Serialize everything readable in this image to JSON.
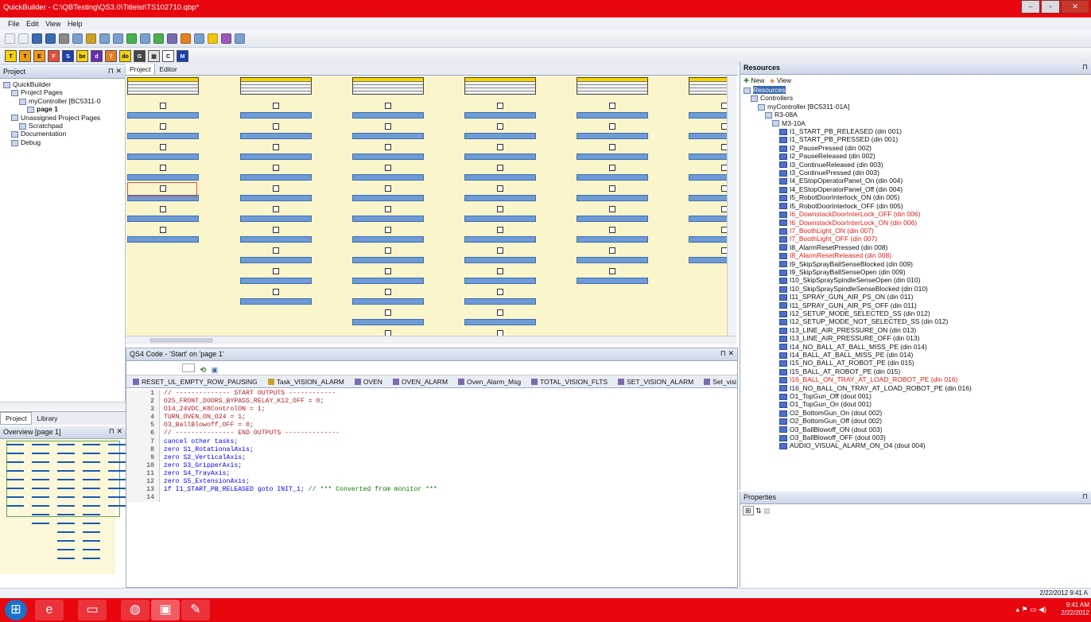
{
  "window": {
    "title": "QuickBuilder - C:\\QBTesting\\QS3.0\\Titleist\\TS102710.qbp*",
    "minimize": "–",
    "maximize": "▫",
    "close": "✕"
  },
  "menu": [
    "File",
    "Edit",
    "View",
    "Help"
  ],
  "toolbar2": [
    {
      "t": "T",
      "c": "#f7d300",
      "fg": "#000"
    },
    {
      "t": "T",
      "c": "#f39c12",
      "fg": "#000"
    },
    {
      "t": "E",
      "c": "#f39c12",
      "fg": "#000"
    },
    {
      "t": "F",
      "c": "#e74c3c",
      "fg": "#fff"
    },
    {
      "t": "S",
      "c": "#1a3fb0",
      "fg": "#fff"
    },
    {
      "t": "be",
      "c": "#f7d300",
      "fg": "#000"
    },
    {
      "t": "d",
      "c": "#6b2bb0",
      "fg": "#fff"
    },
    {
      "t": "?",
      "c": "#e67e22",
      "fg": "#fff"
    },
    {
      "t": "do",
      "c": "#f7d300",
      "fg": "#000"
    },
    {
      "t": "G",
      "c": "#444",
      "fg": "#fff"
    },
    {
      "t": "▦",
      "c": "#e0e0e0",
      "fg": "#333"
    },
    {
      "t": "C",
      "c": "#fff",
      "fg": "#000"
    },
    {
      "t": "M",
      "c": "#1a3fb0",
      "fg": "#fff"
    }
  ],
  "project": {
    "panel_title": "Project",
    "pin": "⊓ ✕",
    "tree": [
      {
        "label": "QuickBuilder",
        "indent": 0
      },
      {
        "label": "Project Pages",
        "indent": 1
      },
      {
        "label": "myController [BC5311-0",
        "indent": 2
      },
      {
        "label": "page 1",
        "indent": 3,
        "bold": true
      },
      {
        "label": "Unassigned Project Pages",
        "indent": 1
      },
      {
        "label": "Scratchpad",
        "indent": 2
      },
      {
        "label": "Documentation",
        "indent": 1
      },
      {
        "label": "Debug",
        "indent": 1
      }
    ],
    "tab_project": "Project",
    "tab_library": "Library"
  },
  "overview": {
    "title": "Overview [page 1]",
    "pin": "⊓ ✕"
  },
  "editor": {
    "tab_project": "Project",
    "tab_editor": "Editor"
  },
  "code": {
    "title": "QS4 Code - 'Start' on 'page 1'",
    "pin": "⊓ ✕",
    "tabs": [
      "RESET_UL_EMPTY_ROW_PAUSING",
      "Task_VISION_ALARM",
      "OVEN",
      "OVEN_ALARM",
      "Oven_Alarm_Msg",
      "TOTAL_VISION_FLTS",
      "SET_VISION_ALARM",
      "Set_visi"
    ],
    "lines": [
      {
        "n": "1",
        "text": "// -------------- START OUTPUTS ------------",
        "cls": "plain"
      },
      {
        "n": "2",
        "text": "O25_FRONT_DOORS_BYPASS_RELAY_K12_OFF = 0;",
        "cls": "plain"
      },
      {
        "n": "3",
        "text": "O14_24VDC_K8ControlON = 1;",
        "cls": "plain"
      },
      {
        "n": "4",
        "text": "TURN_OVEN_ON_O24 = 1;",
        "cls": "plain"
      },
      {
        "n": "5",
        "text": "O3_BallBlowoff_OFF = 0;",
        "cls": "plain"
      },
      {
        "n": "6",
        "text": "// --------------- END OUTPUTS --------------",
        "cls": "plain"
      },
      {
        "n": "7",
        "text": "cancel other tasks;",
        "cls": "kw"
      },
      {
        "n": "8",
        "text": "zero S1_RotationalAxis;",
        "cls": "kw"
      },
      {
        "n": "9",
        "text": "zero S2_VerticalAxis;",
        "cls": "kw"
      },
      {
        "n": "10",
        "text": "zero S3_GripperAxis;",
        "cls": "kw"
      },
      {
        "n": "11",
        "text": "zero S4_TrayAxis;",
        "cls": "kw"
      },
      {
        "n": "12",
        "text": "zero S5_ExtensionAxis;",
        "cls": "kw"
      },
      {
        "n": "13",
        "text": "if I1_START_PB_RELEASED goto INIT_1; // *** Converted from monitor ***",
        "cls": "kw"
      },
      {
        "n": "14",
        "text": "",
        "cls": "plain"
      }
    ]
  },
  "resources": {
    "title": "Resources",
    "new": "New",
    "view": "View",
    "root": "Resources",
    "controllers": "Controllers",
    "controller": "myController [BC5311-01A]",
    "rack": "R3-08A",
    "module": "M3-10A",
    "io": [
      {
        "t": "I1_START_PB_RELEASED (din 001)",
        "red": false
      },
      {
        "t": "I1_START_PB_PRESSED (din 001)",
        "red": false
      },
      {
        "t": "I2_PausePressed (din 002)",
        "red": false
      },
      {
        "t": "I2_PauseReleased (din 002)",
        "red": false
      },
      {
        "t": "I3_ContinueReleased (din 003)",
        "red": false
      },
      {
        "t": "I3_ContinuePressed (din 003)",
        "red": false
      },
      {
        "t": "I4_EStopOperatorPanel_On (din 004)",
        "red": false
      },
      {
        "t": "I4_EStopOperatorPanel_Off (din 004)",
        "red": false
      },
      {
        "t": "I5_RobotDoorInterlock_ON (din 005)",
        "red": false
      },
      {
        "t": "I5_RobotDoorInterlock_OFF (din 005)",
        "red": false
      },
      {
        "t": "I6_DownstackDoorInterLock_OFF (din 006)",
        "red": true
      },
      {
        "t": "I6_DownstackDoorInterLock_ON (din 006)",
        "red": true
      },
      {
        "t": "I7_BoothLight_ON (din 007)",
        "red": true
      },
      {
        "t": "I7_BoothLight_OFF (din 007)",
        "red": true
      },
      {
        "t": "I8_AlarmResetPressed (din 008)",
        "red": false
      },
      {
        "t": "I8_AlarmResetReleased (din 008)",
        "red": true
      },
      {
        "t": "I9_SkipSprayBallSenseBlocked (din 009)",
        "red": false
      },
      {
        "t": "I9_SkipSprayBallSenseOpen (din 009)",
        "red": false
      },
      {
        "t": "I10_SkipSpraySpindleSenseOpen (din 010)",
        "red": false
      },
      {
        "t": "I10_SkipSpraySpindleSenseBlocked (din 010)",
        "red": false
      },
      {
        "t": "I11_SPRAY_GUN_AIR_PS_ON (din 011)",
        "red": false
      },
      {
        "t": "I11_SPRAY_GUN_AIR_PS_OFF (din 011)",
        "red": false
      },
      {
        "t": "I12_SETUP_MODE_SELECTED_SS (din 012)",
        "red": false
      },
      {
        "t": "I12_SETUP_MODE_NOT_SELECTED_SS (din 012)",
        "red": false
      },
      {
        "t": "I13_LINE_AIR_PRESSURE_ON (din 013)",
        "red": false
      },
      {
        "t": "I13_LINE_AIR_PRESSURE_OFF (din 013)",
        "red": false
      },
      {
        "t": "I14_NO_BALL_AT_BALL_MISS_PE (din 014)",
        "red": false
      },
      {
        "t": "I14_BALL_AT_BALL_MISS_PE (din 014)",
        "red": false
      },
      {
        "t": "I15_NO_BALL_AT_ROBOT_PE (din 015)",
        "red": false
      },
      {
        "t": "I15_BALL_AT_ROBOT_PE (din 015)",
        "red": false
      },
      {
        "t": "I16_BALL_ON_TRAY_AT_LOAD_ROBOT_PE (din 016)",
        "red": true
      },
      {
        "t": "I16_NO_BALL_ON_TRAY_AT_LOAD_ROBOT_PE (din 016)",
        "red": false
      },
      {
        "t": "O1_TopGun_Off (dout 001)",
        "red": false
      },
      {
        "t": "O1_TopGun_On (dout 001)",
        "red": false
      },
      {
        "t": "O2_BottomGun_On (dout 002)",
        "red": false
      },
      {
        "t": "O2_BottomGun_Off (dout 002)",
        "red": false
      },
      {
        "t": "O3_BallBlowoff_ON (dout 003)",
        "red": false
      },
      {
        "t": "O3_BallBlowoff_OFF (dout 003)",
        "red": false
      },
      {
        "t": "AUDIO_VISUAL_ALARM_ON_O4 (dout 004)",
        "red": false
      }
    ]
  },
  "properties": {
    "title": "Properties"
  },
  "status": {
    "text": "2/22/2012   9:41 A"
  },
  "clock": {
    "time": "9:41 AM",
    "date": "2/22/2012"
  }
}
